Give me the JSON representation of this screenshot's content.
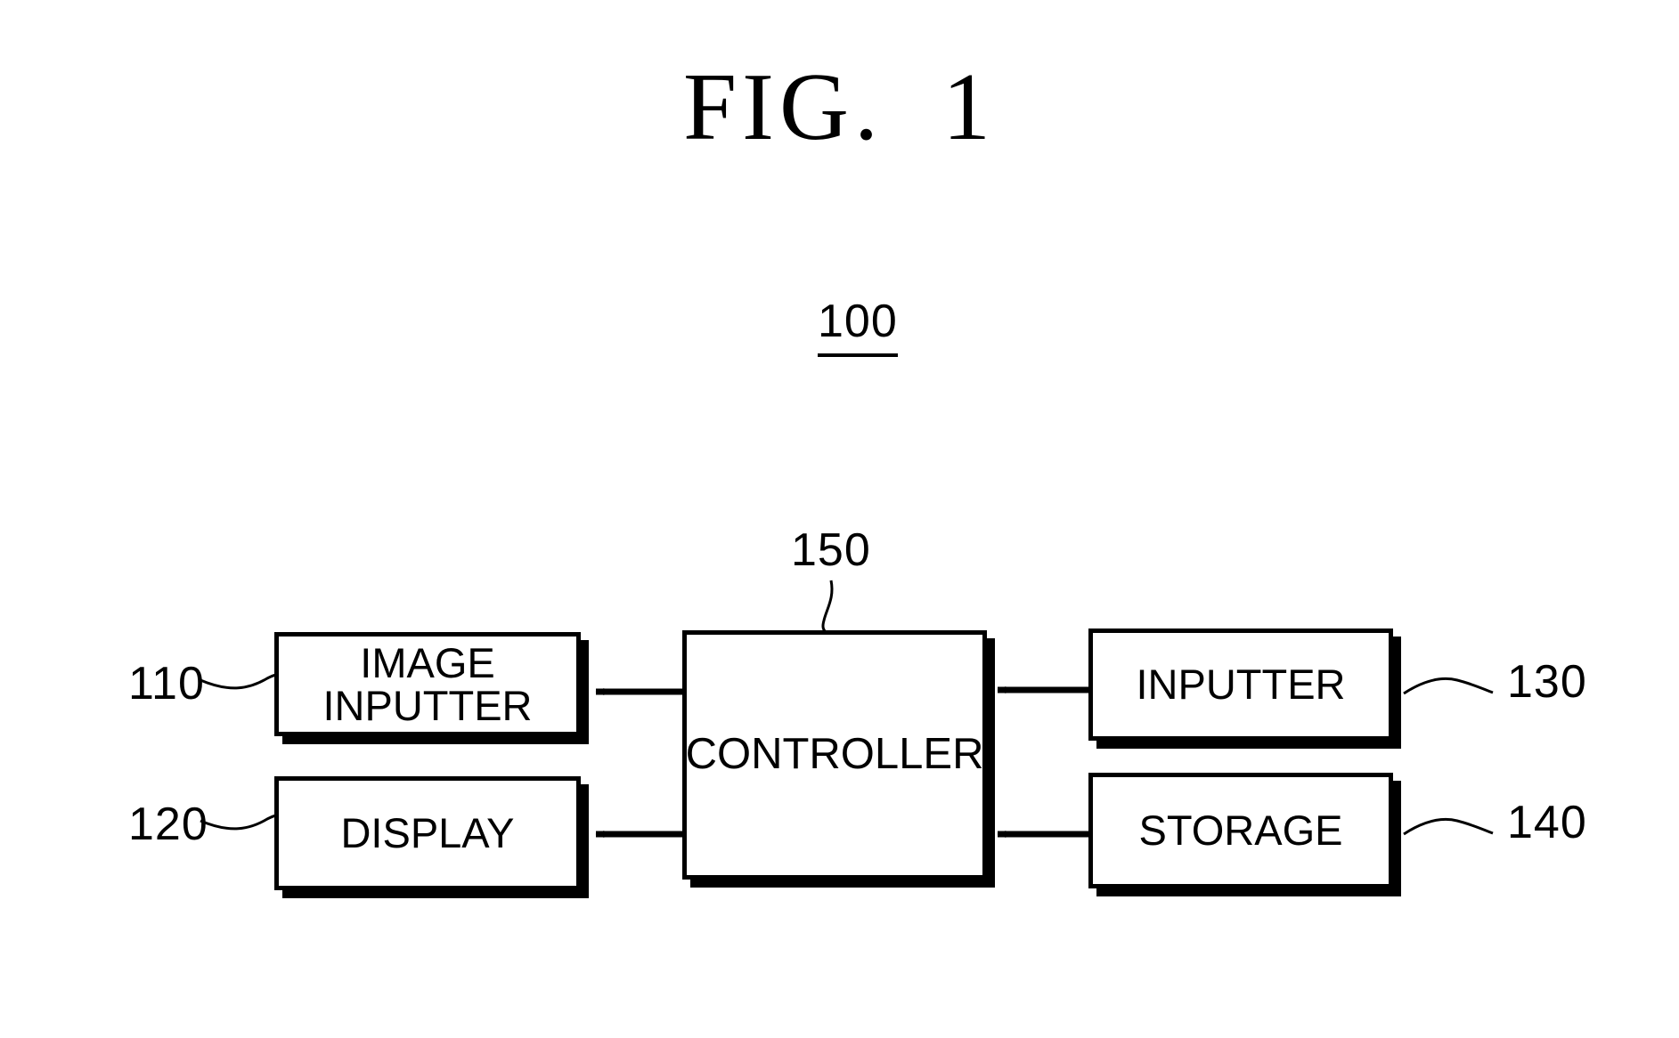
{
  "figure": {
    "title": "FIG.  1",
    "system_label": "100",
    "controller_ref": "150"
  },
  "blocks": [
    {
      "id": "image-inputter",
      "label": "IMAGE\nINPUTTER",
      "ref": "110"
    },
    {
      "id": "display",
      "label": "DISPLAY",
      "ref": "120"
    },
    {
      "id": "controller",
      "label": "CONTROLLER",
      "ref": "150"
    },
    {
      "id": "inputter",
      "label": "INPUTTER",
      "ref": "130"
    },
    {
      "id": "storage",
      "label": "STORAGE",
      "ref": "140"
    }
  ],
  "refs": {
    "image_inputter": "110",
    "display": "120",
    "inputter": "130",
    "storage": "140",
    "controller": "150",
    "system": "100"
  },
  "connections": [
    {
      "from": "image-inputter",
      "to": "controller",
      "arrow": "bidirectional"
    },
    {
      "from": "display",
      "to": "controller",
      "arrow": "bidirectional"
    },
    {
      "from": "controller",
      "to": "inputter",
      "arrow": "bidirectional"
    },
    {
      "from": "controller",
      "to": "storage",
      "arrow": "bidirectional"
    }
  ],
  "colors": {
    "line": "#000000",
    "background": "#ffffff",
    "shadow": "#000000"
  }
}
